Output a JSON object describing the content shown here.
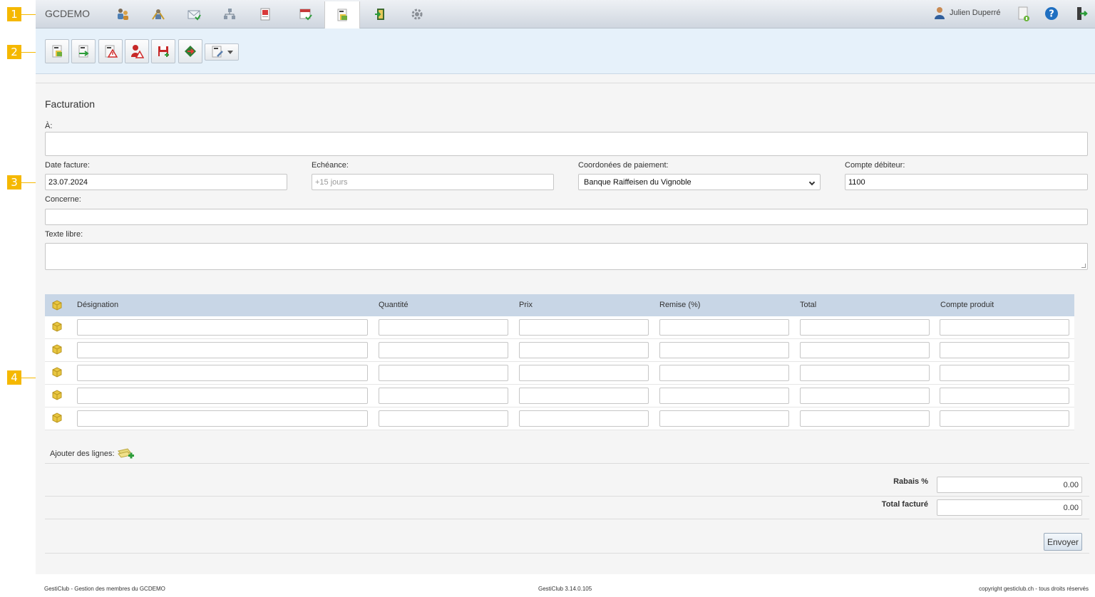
{
  "callouts": [
    "1",
    "2",
    "3",
    "4"
  ],
  "app": {
    "brand": "GCDEMO",
    "nav_icons": [
      "members-icon",
      "worker-icon",
      "mail-icon",
      "organization-icon",
      "report-icon",
      "calendar-icon",
      "invoice-icon",
      "exit-door-icon",
      "settings-gear-icon"
    ],
    "active_nav_index": 6,
    "user_name": "Julien Duperré",
    "top_right_icons": [
      "document-info-icon",
      "help-icon",
      "logout-icon"
    ]
  },
  "toolbar": {
    "buttons": [
      "new-invoice-icon",
      "send-invoice-icon",
      "invoice-warning-icon",
      "member-alert-icon",
      "save-icon",
      "export-icon"
    ],
    "dropdown_icon": "invoice-tools-icon"
  },
  "form": {
    "title": "Facturation",
    "to_label": "À:",
    "to_value": "",
    "date_label": "Date facture:",
    "date_value": "23.07.2024",
    "due_label": "Echéance:",
    "due_placeholder": "+15 jours",
    "payment_label": "Coordonées de paiement:",
    "payment_value": "Banque Raiffeisen du Vignoble",
    "account_label": "Compte débiteur:",
    "account_value": "1100",
    "subject_label": "Concerne:",
    "subject_value": "",
    "freetext_label": "Texte libre:",
    "freetext_value": ""
  },
  "table": {
    "columns": [
      "Désignation",
      "Quantité",
      "Prix",
      "Remise (%)",
      "Total",
      "Compte produit"
    ],
    "row_count": 5
  },
  "add_lines_label": "Ajouter des lignes:",
  "summary": {
    "discount_label": "Rabais %",
    "discount_value": "0.00",
    "total_label": "Total facturé",
    "total_value": "0.00"
  },
  "send_label": "Envoyer",
  "footer": {
    "left": "GestiClub - Gestion des membres du GCDEMO",
    "center": "GestiClub 3.14.0.105",
    "right": "copyright gesticlub.ch - tous droits réservés"
  },
  "colors": {
    "callout": "#f5b800",
    "toolbar_bg": "#e6f1fa",
    "table_header_bg": "#c8d6e6"
  }
}
